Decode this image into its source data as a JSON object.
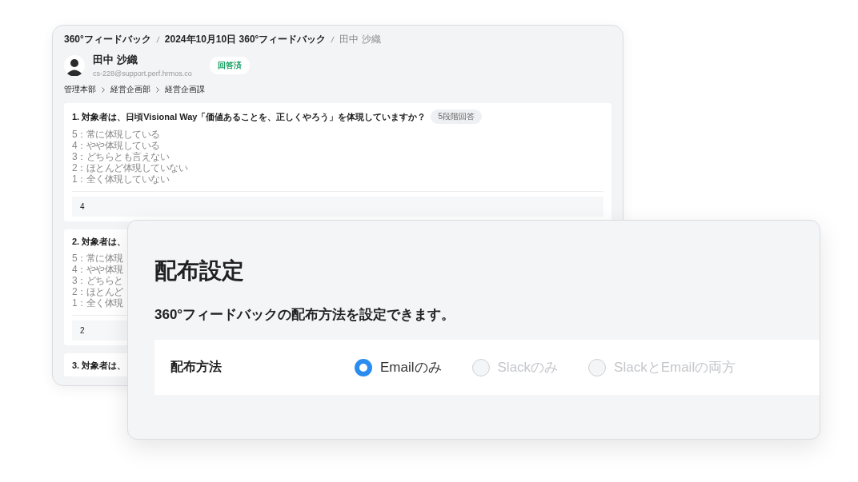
{
  "back_window": {
    "breadcrumb": [
      {
        "label": "360°フィードバック",
        "current": false
      },
      {
        "label": "2024年10月10日 360°フィードバック",
        "current": false
      },
      {
        "label": "田中 沙織",
        "current": true
      }
    ],
    "person": {
      "name": "田中 沙織",
      "email": "cs-228@support.perf.hrmos.co",
      "status": "回答済"
    },
    "departments": [
      "管理本部",
      "経営企画部",
      "経営企画課"
    ],
    "questions": [
      {
        "title": "1. 対象者は、日頃Visional Way「価値あることを、正しくやろう」を体現していますか？",
        "tag": "5段階回答",
        "options": [
          "5：常に体現している",
          "4：やや体現している",
          "3：どちらとも言えない",
          "2：ほとんど体現していない",
          "1：全く体現していない"
        ],
        "answer": "4"
      },
      {
        "title": "2. 対象者は、",
        "options": [
          "5：常に体現",
          "4：やや体現",
          "3：どちらと",
          "2：ほとんど",
          "1：全く体現"
        ],
        "answer": "2"
      },
      {
        "title": "3. 対象者は、"
      }
    ]
  },
  "settings_panel": {
    "title": "配布設定",
    "description": "360°フィードバックの配布方法を設定できます。",
    "field_label": "配布方法",
    "options": [
      {
        "label": "Emailのみ",
        "selected": true,
        "disabled": false
      },
      {
        "label": "Slackのみ",
        "selected": false,
        "disabled": true
      },
      {
        "label": "SlackとEmailの両方",
        "selected": false,
        "disabled": true
      }
    ]
  }
}
